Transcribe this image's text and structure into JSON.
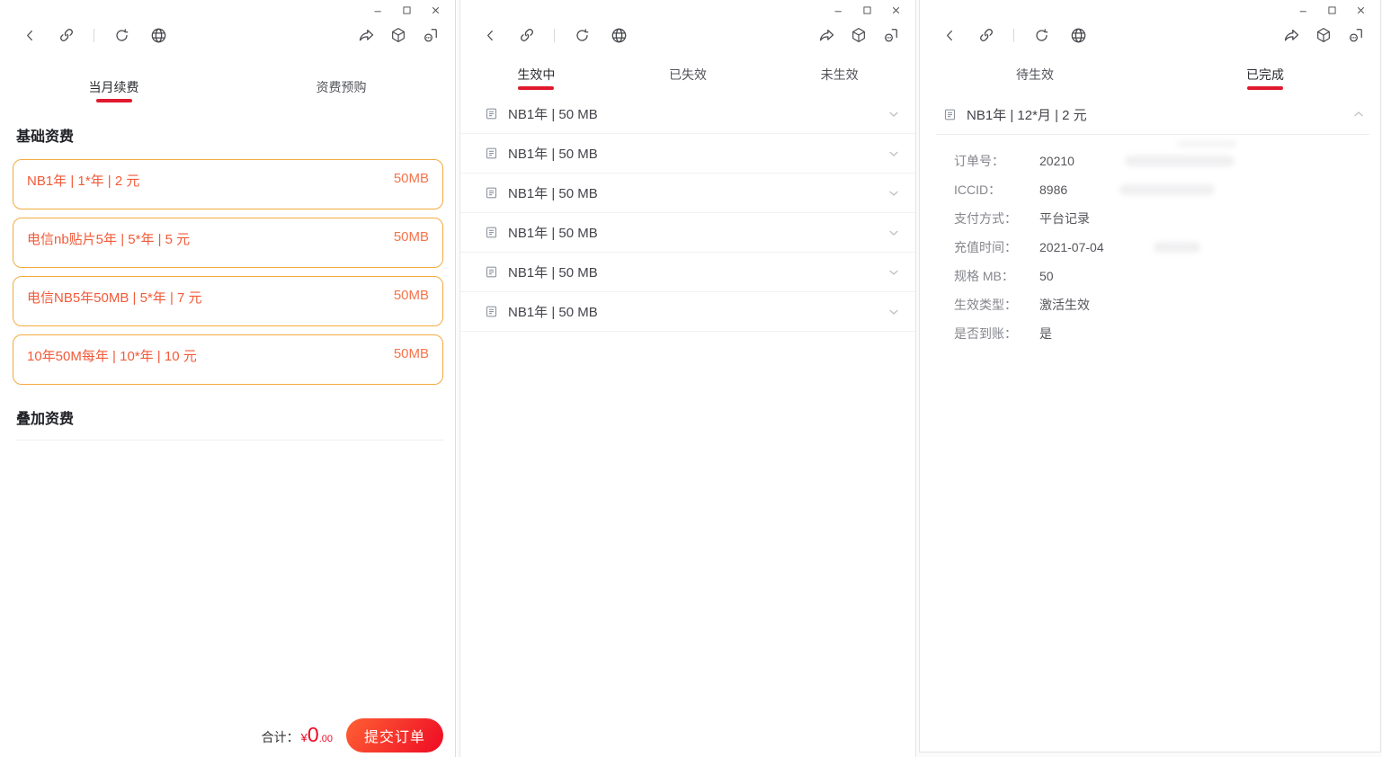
{
  "theme": {
    "accent_red": "#e0192e",
    "amount_red": "#ee0a24",
    "button_gradient": [
      "#ff6034",
      "#ee0a24"
    ],
    "card_border": "#f3ab3f",
    "card_text": "#f25a38"
  },
  "window_controls": {
    "icons": [
      "minimize-icon",
      "maximize-icon",
      "close-icon"
    ]
  },
  "toolbar": {
    "icons": [
      "back-icon",
      "link-icon",
      "refresh-icon",
      "globe-icon",
      "share-icon",
      "cube-icon",
      "capsule-more-icon"
    ]
  },
  "renew_window": {
    "tabs": {
      "current_month": "当月续费",
      "prepurchase": "资费预购"
    },
    "base_section_title": "基础资费",
    "addon_section_title": "叠加资费",
    "plans": [
      {
        "title": "NB1年 | 1*年 | 2 元",
        "size": "50MB"
      },
      {
        "title": "电信nb贴片5年 | 5*年 | 5 元",
        "size": "50MB"
      },
      {
        "title": "电信NB5年50MB | 5*年 | 7 元",
        "size": "50MB"
      },
      {
        "title": "10年50M每年 | 10*年 | 10 元",
        "size": "50MB"
      }
    ],
    "footer": {
      "total_label": "合计：",
      "currency": "¥",
      "amount_int": "0",
      "amount_dec": ".00",
      "submit_label": "提交订单"
    }
  },
  "status_window": {
    "tabs": {
      "active": "生效中",
      "expired": "已失效",
      "not_active": "未生效"
    },
    "items": [
      {
        "label": "NB1年 | 50 MB"
      },
      {
        "label": "NB1年 | 50 MB"
      },
      {
        "label": "NB1年 | 50 MB"
      },
      {
        "label": "NB1年 | 50 MB"
      },
      {
        "label": "NB1年 | 50 MB"
      },
      {
        "label": "NB1年 | 50 MB"
      }
    ]
  },
  "order_window": {
    "tabs": {
      "pending": "待生效",
      "completed": "已完成"
    },
    "header": "NB1年 | 12*月 | 2 元",
    "fields": [
      {
        "label": "订单号：",
        "value": "20210"
      },
      {
        "label": "ICCID：",
        "value": "8986"
      },
      {
        "label": "支付方式：",
        "value": "平台记录"
      },
      {
        "label": "充值时间：",
        "value": "2021-07-04"
      },
      {
        "label": "规格 MB：",
        "value": "50"
      },
      {
        "label": "生效类型：",
        "value": "激活生效"
      },
      {
        "label": "是否到账：",
        "value": "是"
      }
    ]
  }
}
